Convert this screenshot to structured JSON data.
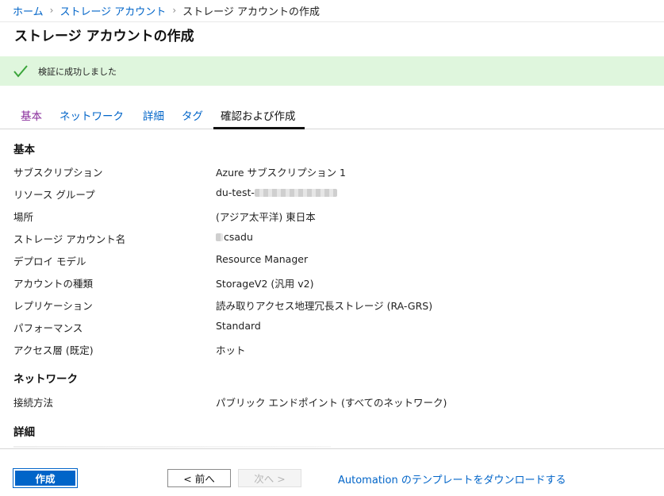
{
  "breadcrumb": {
    "home": "ホーム",
    "storage_accounts": "ストレージ アカウント",
    "current": "ストレージ アカウントの作成"
  },
  "page_title": "ストレージ アカウントの作成",
  "banner": {
    "message": "検証に成功しました",
    "icon": "check-icon",
    "color": "#dff6dd"
  },
  "tabs": [
    {
      "label": "基本",
      "state": "visited"
    },
    {
      "label": "ネットワーク",
      "state": "link"
    },
    {
      "label": "詳細",
      "state": "link"
    },
    {
      "label": "タグ",
      "state": "link"
    },
    {
      "label": "確認および作成",
      "state": "active"
    }
  ],
  "sections": {
    "basics": {
      "title": "基本",
      "rows": [
        {
          "label": "サブスクリプション",
          "value": "Azure サブスクリプション 1"
        },
        {
          "label": "リソース グループ",
          "value": "du-test-"
        },
        {
          "label": "場所",
          "value": "(アジア太平洋) 東日本"
        },
        {
          "label": "ストレージ アカウント名",
          "value": "csadu"
        },
        {
          "label": "デプロイ モデル",
          "value": "Resource Manager"
        },
        {
          "label": "アカウントの種類",
          "value": "StorageV2 (汎用 v2)"
        },
        {
          "label": "レプリケーション",
          "value": "読み取りアクセス地理冗長ストレージ (RA-GRS)"
        },
        {
          "label": "パフォーマンス",
          "value": "Standard"
        },
        {
          "label": "アクセス層 (既定)",
          "value": "ホット"
        }
      ]
    },
    "network": {
      "title": "ネットワーク",
      "rows": [
        {
          "label": "接続方法",
          "value": "パブリック エンドポイント (すべてのネットワーク)"
        }
      ]
    },
    "advanced": {
      "title": "詳細"
    }
  },
  "footer": {
    "create_label": "作成",
    "prev_label": "< 前へ",
    "next_label": "次へ >",
    "download_link": "Automation のテンプレートをダウンロードする"
  },
  "colors": {
    "link": "#0064c8",
    "visited": "#8a2f9c",
    "primary": "#0064c8"
  }
}
